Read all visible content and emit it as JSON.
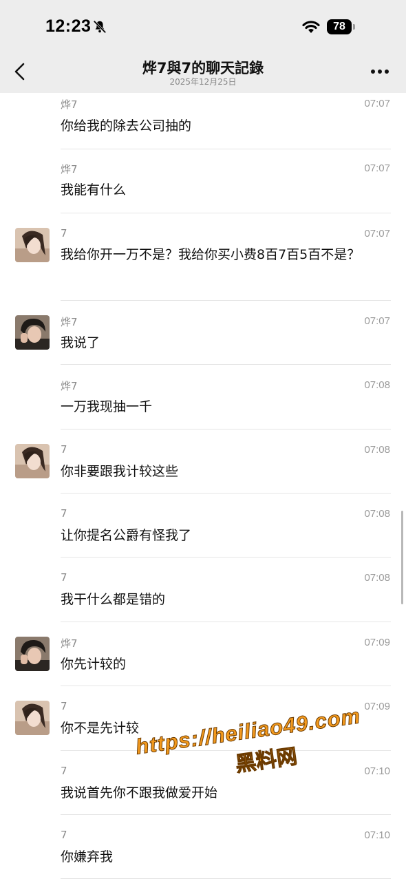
{
  "status_bar": {
    "time": "12:23",
    "battery": "78"
  },
  "header": {
    "title": "烨7與7的聊天記錄",
    "subtitle": "2025年12月25日"
  },
  "messages": [
    {
      "sender": "烨7",
      "time": "07:07",
      "text": "你给我的除去公司抽的",
      "avatar": ""
    },
    {
      "sender": "烨7",
      "time": "07:07",
      "text": "我能有什么",
      "avatar": ""
    },
    {
      "sender": "7",
      "time": "07:07",
      "text": "我给你开一万不是？我给你买小费8百7百5百不是？",
      "avatar": "female"
    },
    {
      "sender": "烨7",
      "time": "07:07",
      "text": "我说了",
      "avatar": "male"
    },
    {
      "sender": "烨7",
      "time": "07:08",
      "text": "一万我现抽一千",
      "avatar": ""
    },
    {
      "sender": "7",
      "time": "07:08",
      "text": "你非要跟我计较这些",
      "avatar": "female"
    },
    {
      "sender": "7",
      "time": "07:08",
      "text": "让你提名公爵有怪我了",
      "avatar": ""
    },
    {
      "sender": "7",
      "time": "07:08",
      "text": "我干什么都是错的",
      "avatar": ""
    },
    {
      "sender": "烨7",
      "time": "07:09",
      "text": "你先计较的",
      "avatar": "male"
    },
    {
      "sender": "7",
      "time": "07:09",
      "text": "你不是先计较",
      "avatar": "female"
    },
    {
      "sender": "7",
      "time": "07:10",
      "text": "我说首先你不跟我做爱开始",
      "avatar": ""
    },
    {
      "sender": "7",
      "time": "07:10",
      "text": "你嫌弃我",
      "avatar": ""
    }
  ],
  "watermark": {
    "url": "https://heiliao49.com",
    "name": "黑料网"
  },
  "colors": {
    "header_bg": "#ededed",
    "watermark": "#f39a1e"
  }
}
